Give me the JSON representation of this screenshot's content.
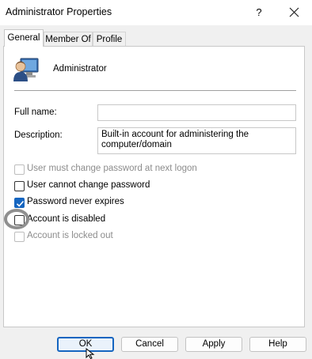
{
  "window": {
    "title": "Administrator Properties",
    "help_label": "?"
  },
  "tabs": [
    {
      "label": "General",
      "active": true
    },
    {
      "label": "Member Of",
      "active": false
    },
    {
      "label": "Profile",
      "active": false
    }
  ],
  "user": {
    "name": "Administrator",
    "icon": "user-icon"
  },
  "fields": {
    "full_name_label": "Full name:",
    "full_name_value": "",
    "description_label": "Description:",
    "description_line1": "Built-in account for administering the",
    "description_line2": "computer/domain"
  },
  "checkboxes": [
    {
      "label": "User must change password at next logon",
      "checked": false,
      "enabled": false
    },
    {
      "label": "User cannot change password",
      "checked": false,
      "enabled": true
    },
    {
      "label": "Password never expires",
      "checked": true,
      "enabled": true
    },
    {
      "label": "Account is disabled",
      "checked": false,
      "enabled": true
    },
    {
      "label": "Account is locked out",
      "checked": false,
      "enabled": false
    }
  ],
  "buttons": {
    "ok": "OK",
    "cancel": "Cancel",
    "apply": "Apply",
    "help": "Help"
  },
  "colors": {
    "accent": "#1565c0",
    "highlight_ring": "#8f8f8f"
  }
}
